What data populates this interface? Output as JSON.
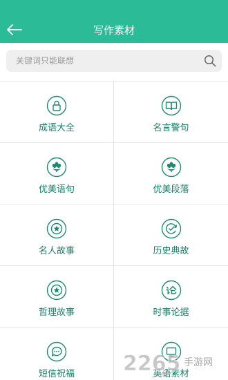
{
  "header": {
    "title": "写作素材",
    "back_icon": "arrow-left-icon"
  },
  "search": {
    "placeholder": "关键词只能联想",
    "value": ""
  },
  "colors": {
    "accent": "#2bbb97",
    "label": "#147f66",
    "icon": "#1d8a6f"
  },
  "items": [
    {
      "label": "成语大全",
      "icon": "lock-icon"
    },
    {
      "label": "名言警句",
      "icon": "book-icon"
    },
    {
      "label": "优美语句",
      "icon": "flower-icon"
    },
    {
      "label": "优美段落",
      "icon": "flower-icon"
    },
    {
      "label": "名人故事",
      "icon": "star-icon"
    },
    {
      "label": "历史典故",
      "icon": "refresh-check-icon"
    },
    {
      "label": "哲理故事",
      "icon": "star-icon"
    },
    {
      "label": "时事论据",
      "icon": "lun-icon"
    },
    {
      "label": "短信祝福",
      "icon": "chat-icon"
    },
    {
      "label": "英语素材",
      "icon": "screen-icon"
    }
  ],
  "watermark": {
    "number": "2265",
    "domain": ".com",
    "text": "手游网"
  }
}
